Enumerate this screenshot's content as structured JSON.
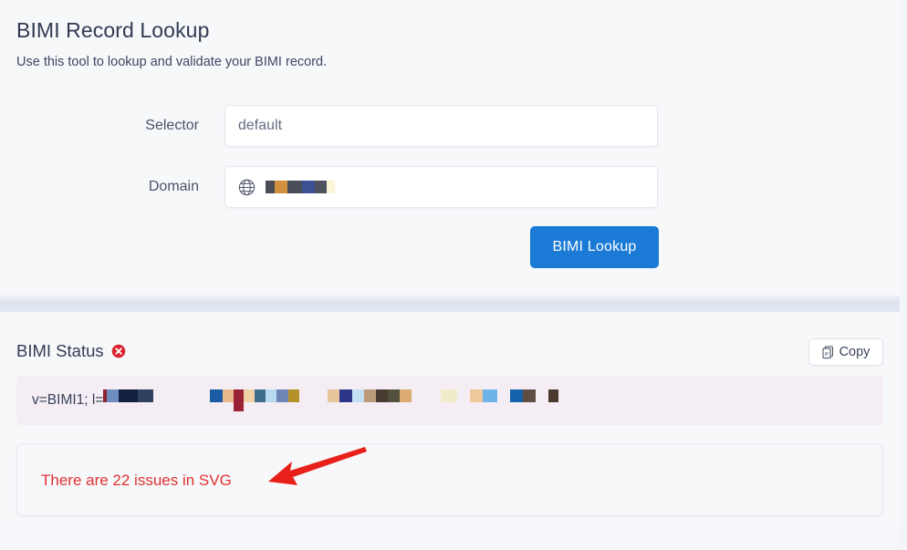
{
  "header": {
    "title": "BIMI Record Lookup",
    "subtitle": "Use this tool to lookup and validate your BIMI record."
  },
  "form": {
    "selector": {
      "label": "Selector",
      "value": "default"
    },
    "domain": {
      "label": "Domain",
      "value": "",
      "icon": "globe-icon",
      "redacted": true,
      "redaction_blocks": [
        {
          "w": 10,
          "color": "#474c57"
        },
        {
          "w": 14,
          "color": "#d3913f"
        },
        {
          "w": 16,
          "color": "#4a4e5a"
        },
        {
          "w": 14,
          "color": "#3e5193"
        },
        {
          "w": 13,
          "color": "#4d535e"
        },
        {
          "w": 9,
          "color": "#fbf6d6"
        }
      ]
    },
    "submit_label": "BIMI Lookup"
  },
  "results": {
    "status_title": "BIMI Status",
    "status_icon": "error-circle-x-icon",
    "status_color": "#d9232d",
    "copy_label": "Copy",
    "copy_icon": "copy-document-icon",
    "record_prefix": "v=BIMI1; l=",
    "record_redaction_groups": [
      {
        "gap": 0,
        "blocks": [
          {
            "w": 4,
            "h": 14,
            "color": "#8e2330"
          },
          {
            "w": 13,
            "h": 14,
            "color": "#6d8cc0"
          },
          {
            "w": 21,
            "h": 14,
            "color": "#15203f"
          },
          {
            "w": 17,
            "h": 14,
            "color": "#2e4160"
          }
        ]
      },
      {
        "gap": 62,
        "blocks": [
          {
            "w": 14,
            "h": 14,
            "color": "#1b5ba4"
          },
          {
            "w": 12,
            "h": 14,
            "color": "#eab98a"
          },
          {
            "w": 11,
            "h": 24,
            "color": "#9b2338"
          },
          {
            "w": 12,
            "h": 14,
            "color": "#f0d2a6"
          },
          {
            "w": 12,
            "h": 14,
            "color": "#3f6e8c"
          },
          {
            "w": 12,
            "h": 14,
            "color": "#b7daf0"
          },
          {
            "w": 13,
            "h": 14,
            "color": "#6f85b5"
          },
          {
            "w": 12,
            "h": 14,
            "color": "#b69129"
          }
        ]
      },
      {
        "gap": 31,
        "blocks": [
          {
            "w": 13,
            "h": 14,
            "color": "#e7c59c"
          },
          {
            "w": 14,
            "h": 14,
            "color": "#2c3587"
          },
          {
            "w": 13,
            "h": 14,
            "color": "#c3dff2"
          },
          {
            "w": 13,
            "h": 14,
            "color": "#bb9a79"
          },
          {
            "w": 13,
            "h": 14,
            "color": "#483c33"
          },
          {
            "w": 13,
            "h": 14,
            "color": "#53503f"
          },
          {
            "w": 13,
            "h": 14,
            "color": "#dcab72"
          }
        ]
      },
      {
        "gap": 32,
        "blocks": [
          {
            "w": 18,
            "h": 14,
            "color": "#f0ecc9"
          }
        ]
      },
      {
        "gap": 14,
        "blocks": [
          {
            "w": 14,
            "h": 14,
            "color": "#eec79a"
          },
          {
            "w": 16,
            "h": 14,
            "color": "#6cb4e9"
          }
        ]
      },
      {
        "gap": 14,
        "blocks": [
          {
            "w": 14,
            "h": 14,
            "color": "#1564ab"
          },
          {
            "w": 14,
            "h": 14,
            "color": "#5f4c42"
          }
        ]
      },
      {
        "gap": 14,
        "blocks": [
          {
            "w": 11,
            "h": 14,
            "color": "#4b382f"
          }
        ]
      }
    ]
  },
  "issues": {
    "message": "There are 22 issues in SVG",
    "count": 22,
    "color": "#e03131",
    "annotation": {
      "type": "arrow",
      "color": "#e8201a",
      "direction": "left"
    }
  }
}
